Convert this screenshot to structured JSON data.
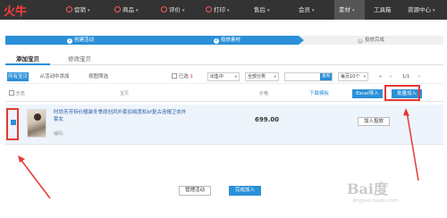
{
  "nav": {
    "logo": "火牛",
    "items": [
      {
        "label": "促销"
      },
      {
        "label": "商品"
      },
      {
        "label": "评价"
      },
      {
        "label": "打印"
      },
      {
        "label": "售后"
      },
      {
        "label": "会员"
      },
      {
        "label": "素材"
      },
      {
        "label": "工具箱"
      },
      {
        "label": "资源中心"
      }
    ],
    "active_index": 6
  },
  "steps": [
    {
      "num": "1",
      "label": "创建活动"
    },
    {
      "num": "2",
      "label": "投放素材"
    },
    {
      "num": "3",
      "label": "投放完成"
    }
  ],
  "tabs": [
    "添加宝贝",
    "修改宝贝"
  ],
  "filters": {
    "all": "所有宝贝",
    "from_activity": "从活动中添加",
    "filter": "按图筛选",
    "checkbox_label": "已选",
    "checkbox_count": "1",
    "sale_status": "出售中",
    "category": "全部分类",
    "search_button": "查询",
    "per_page": "每页10个",
    "page": "1/1"
  },
  "table": {
    "select_all": "全选",
    "col_item": "宝贝",
    "col_price": "价格",
    "download_template": "下载模板",
    "excel_import": "Excel导入",
    "batch_add": "批量加入"
  },
  "item": {
    "title": "时尚芳芳特价靓装冬季原创风外套加绒宽松bf复古连帽卫衣外套女",
    "sub": "编码:",
    "price": "699.00",
    "add_button": "加入投放"
  },
  "bottom": {
    "manage": "管理活动",
    "finish": "完成加入"
  },
  "watermark": {
    "text": "Bai度",
    "sub": "jingyan.baidu.com"
  },
  "colors": {
    "accent": "#2a90d8",
    "nav_bg": "#333333",
    "annotation": "#e53935",
    "logo": "#ff3b3b"
  }
}
